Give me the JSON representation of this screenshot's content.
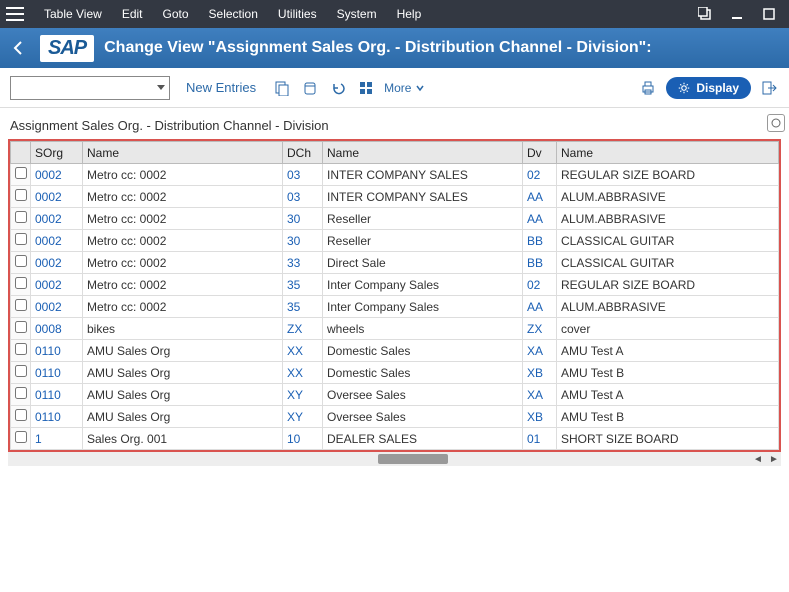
{
  "menu": {
    "items": [
      "Table View",
      "Edit",
      "Goto",
      "Selection",
      "Utilities",
      "System",
      "Help"
    ]
  },
  "header": {
    "logo": "SAP",
    "title": "Change View \"Assignment Sales Org. - Distribution Channel - Division\":"
  },
  "toolbar": {
    "new_entries": "New Entries",
    "more": "More",
    "display": "Display"
  },
  "section": {
    "title": "Assignment Sales Org. - Distribution Channel - Division"
  },
  "columns": {
    "sorg": "SOrg",
    "name1": "Name",
    "dch": "DCh",
    "name2": "Name",
    "dv": "Dv",
    "name3": "Name"
  },
  "rows": [
    {
      "sorg": "0002",
      "n1": "Metro cc: 0002",
      "dch": "03",
      "n2": "INTER COMPANY SALES",
      "dv": "02",
      "n3": "REGULAR SIZE BOARD"
    },
    {
      "sorg": "0002",
      "n1": "Metro cc: 0002",
      "dch": "03",
      "n2": "INTER COMPANY SALES",
      "dv": "AA",
      "n3": "ALUM.ABBRASIVE"
    },
    {
      "sorg": "0002",
      "n1": "Metro cc: 0002",
      "dch": "30",
      "n2": "Reseller",
      "dv": "AA",
      "n3": "ALUM.ABBRASIVE"
    },
    {
      "sorg": "0002",
      "n1": "Metro cc: 0002",
      "dch": "30",
      "n2": "Reseller",
      "dv": "BB",
      "n3": "CLASSICAL GUITAR"
    },
    {
      "sorg": "0002",
      "n1": "Metro cc: 0002",
      "dch": "33",
      "n2": "Direct Sale",
      "dv": "BB",
      "n3": "CLASSICAL GUITAR"
    },
    {
      "sorg": "0002",
      "n1": "Metro cc: 0002",
      "dch": "35",
      "n2": "Inter Company Sales",
      "dv": "02",
      "n3": "REGULAR SIZE BOARD"
    },
    {
      "sorg": "0002",
      "n1": "Metro cc: 0002",
      "dch": "35",
      "n2": "Inter Company Sales",
      "dv": "AA",
      "n3": "ALUM.ABBRASIVE"
    },
    {
      "sorg": "0008",
      "n1": "bikes",
      "dch": "ZX",
      "n2": "wheels",
      "dv": "ZX",
      "n3": "cover"
    },
    {
      "sorg": "0110",
      "n1": "AMU Sales Org",
      "dch": "XX",
      "n2": "Domestic Sales",
      "dv": "XA",
      "n3": "AMU Test A"
    },
    {
      "sorg": "0110",
      "n1": "AMU Sales Org",
      "dch": "XX",
      "n2": "Domestic Sales",
      "dv": "XB",
      "n3": "AMU Test B"
    },
    {
      "sorg": "0110",
      "n1": "AMU Sales Org",
      "dch": "XY",
      "n2": "Oversee Sales",
      "dv": "XA",
      "n3": "AMU Test A"
    },
    {
      "sorg": "0110",
      "n1": "AMU Sales Org",
      "dch": "XY",
      "n2": "Oversee Sales",
      "dv": "XB",
      "n3": "AMU Test B"
    },
    {
      "sorg": "1",
      "n1": "Sales Org. 001",
      "dch": "10",
      "n2": "DEALER SALES",
      "dv": "01",
      "n3": "SHORT SIZE BOARD"
    }
  ]
}
